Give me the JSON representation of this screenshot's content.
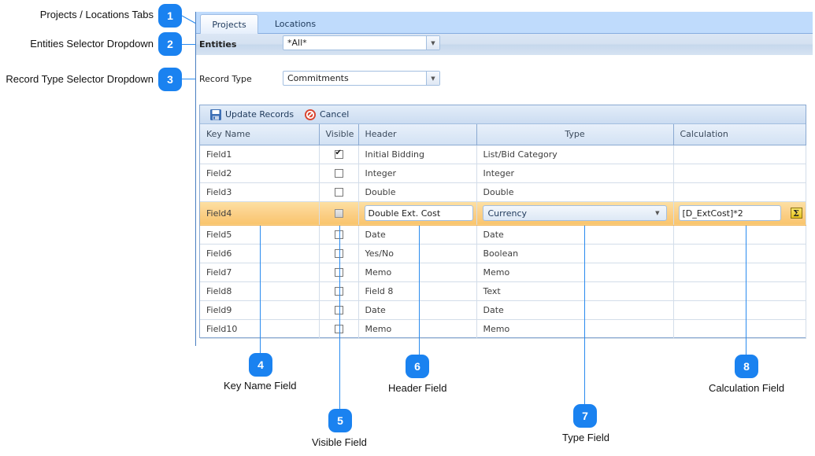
{
  "tabs": [
    {
      "label": "Projects",
      "active": true
    },
    {
      "label": "Locations",
      "active": false
    }
  ],
  "entities": {
    "label": "Entities",
    "value": "*All*"
  },
  "record_type": {
    "label": "Record Type",
    "value": "Commitments"
  },
  "toolbar": {
    "update_label": "Update Records",
    "update_icon": "save-icon",
    "cancel_label": "Cancel",
    "cancel_icon": "cancel-icon"
  },
  "grid": {
    "columns": [
      "Key Name",
      "Visible",
      "Header",
      "Type",
      "Calculation"
    ],
    "rows": [
      {
        "key": "Field1",
        "visible": true,
        "header": "Initial Bidding",
        "type": "List/Bid Category",
        "calc": ""
      },
      {
        "key": "Field2",
        "visible": false,
        "header": "Integer",
        "type": "Integer",
        "calc": ""
      },
      {
        "key": "Field3",
        "visible": false,
        "header": "Double",
        "type": "Double",
        "calc": ""
      },
      {
        "key": "Field4",
        "visible": false,
        "header": "Double Ext. Cost",
        "type": "Currency",
        "calc": "[D_ExtCost]*2",
        "editing": true
      },
      {
        "key": "Field5",
        "visible": false,
        "header": "Date",
        "type": "Date",
        "calc": ""
      },
      {
        "key": "Field6",
        "visible": false,
        "header": "Yes/No",
        "type": "Boolean",
        "calc": ""
      },
      {
        "key": "Field7",
        "visible": false,
        "header": "Memo",
        "type": "Memo",
        "calc": ""
      },
      {
        "key": "Field8",
        "visible": false,
        "header": "Field 8",
        "type": "Text",
        "calc": ""
      },
      {
        "key": "Field9",
        "visible": false,
        "header": "Date",
        "type": "Date",
        "calc": ""
      },
      {
        "key": "Field10",
        "visible": false,
        "header": "Memo",
        "type": "Memo",
        "calc": ""
      }
    ],
    "calc_button_icon": "sigma-icon"
  },
  "callouts": [
    {
      "number": "1",
      "label": "Projects / Locations Tabs"
    },
    {
      "number": "2",
      "label": "Entities Selector Dropdown"
    },
    {
      "number": "3",
      "label": "Record Type Selector Dropdown"
    },
    {
      "number": "4",
      "label": "Key Name Field"
    },
    {
      "number": "5",
      "label": "Visible Field"
    },
    {
      "number": "6",
      "label": "Header Field"
    },
    {
      "number": "7",
      "label": "Type Field"
    },
    {
      "number": "8",
      "label": "Calculation Field"
    }
  ],
  "colors": {
    "callout": "#1a82f0",
    "tabstrip": "#bfdbfc",
    "edit_row": "#fbd089"
  }
}
